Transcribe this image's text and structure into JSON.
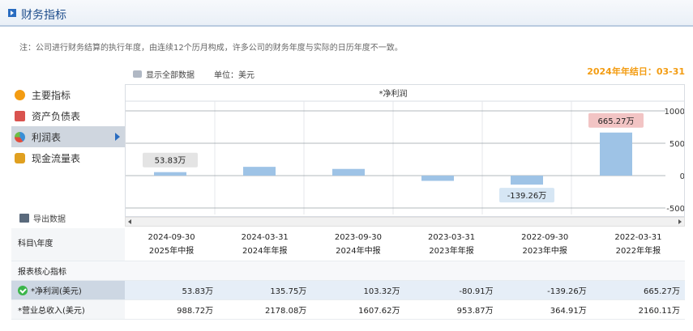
{
  "header": {
    "title": "财务指标"
  },
  "note": "注：公司进行财务结算的执行年度，由连续12个历月构成，许多公司的财务年度与实际的日历年度不一致。",
  "options": {
    "show_all": "显示全部数据",
    "unit": "单位：美元"
  },
  "year_end": "2024年年结日：03-31",
  "menu": [
    {
      "label": "主要指标",
      "icon": "sun-icon",
      "color": "#f39c12"
    },
    {
      "label": "资产负债表",
      "icon": "book-icon",
      "color": "#d9534f"
    },
    {
      "label": "利润表",
      "icon": "pie-icon",
      "color": "#3a8fd6",
      "active": true
    },
    {
      "label": "现金流量表",
      "icon": "coins-icon",
      "color": "#e0a020"
    }
  ],
  "export_label": "导出数据",
  "chart_data": {
    "type": "bar",
    "title": "*净利润",
    "categories": [
      "2024-09-30",
      "2024-03-31",
      "2023-09-30",
      "2023-03-31",
      "2022-09-30",
      "2022-03-31"
    ],
    "values": [
      53.83,
      135.75,
      103.32,
      -80.91,
      -139.26,
      665.27
    ],
    "yticks": [
      1000,
      500,
      0,
      -500
    ],
    "ylim": [
      -600,
      1100
    ],
    "labels": {
      "0": "53.83万",
      "4": "-139.26万",
      "5": "665.27万"
    },
    "bar_color": "#9ec3e6"
  },
  "table": {
    "head_label": "科目\\年度",
    "columns": [
      {
        "date": "2024-09-30",
        "period": "2025年中报"
      },
      {
        "date": "2024-03-31",
        "period": "2024年年报"
      },
      {
        "date": "2023-09-30",
        "period": "2024年中报"
      },
      {
        "date": "2023-03-31",
        "period": "2023年年报"
      },
      {
        "date": "2022-09-30",
        "period": "2023年中报"
      },
      {
        "date": "2022-03-31",
        "period": "2022年年报"
      }
    ],
    "section": "报表核心指标",
    "rows": [
      {
        "label": "*净利润(美元)",
        "values": [
          "53.83万",
          "135.75万",
          "103.32万",
          "-80.91万",
          "-139.26万",
          "665.27万"
        ]
      },
      {
        "label": "*营业总收入(美元)",
        "values": [
          "988.72万",
          "2178.08万",
          "1607.62万",
          "953.87万",
          "364.91万",
          "2160.11万"
        ]
      }
    ]
  }
}
